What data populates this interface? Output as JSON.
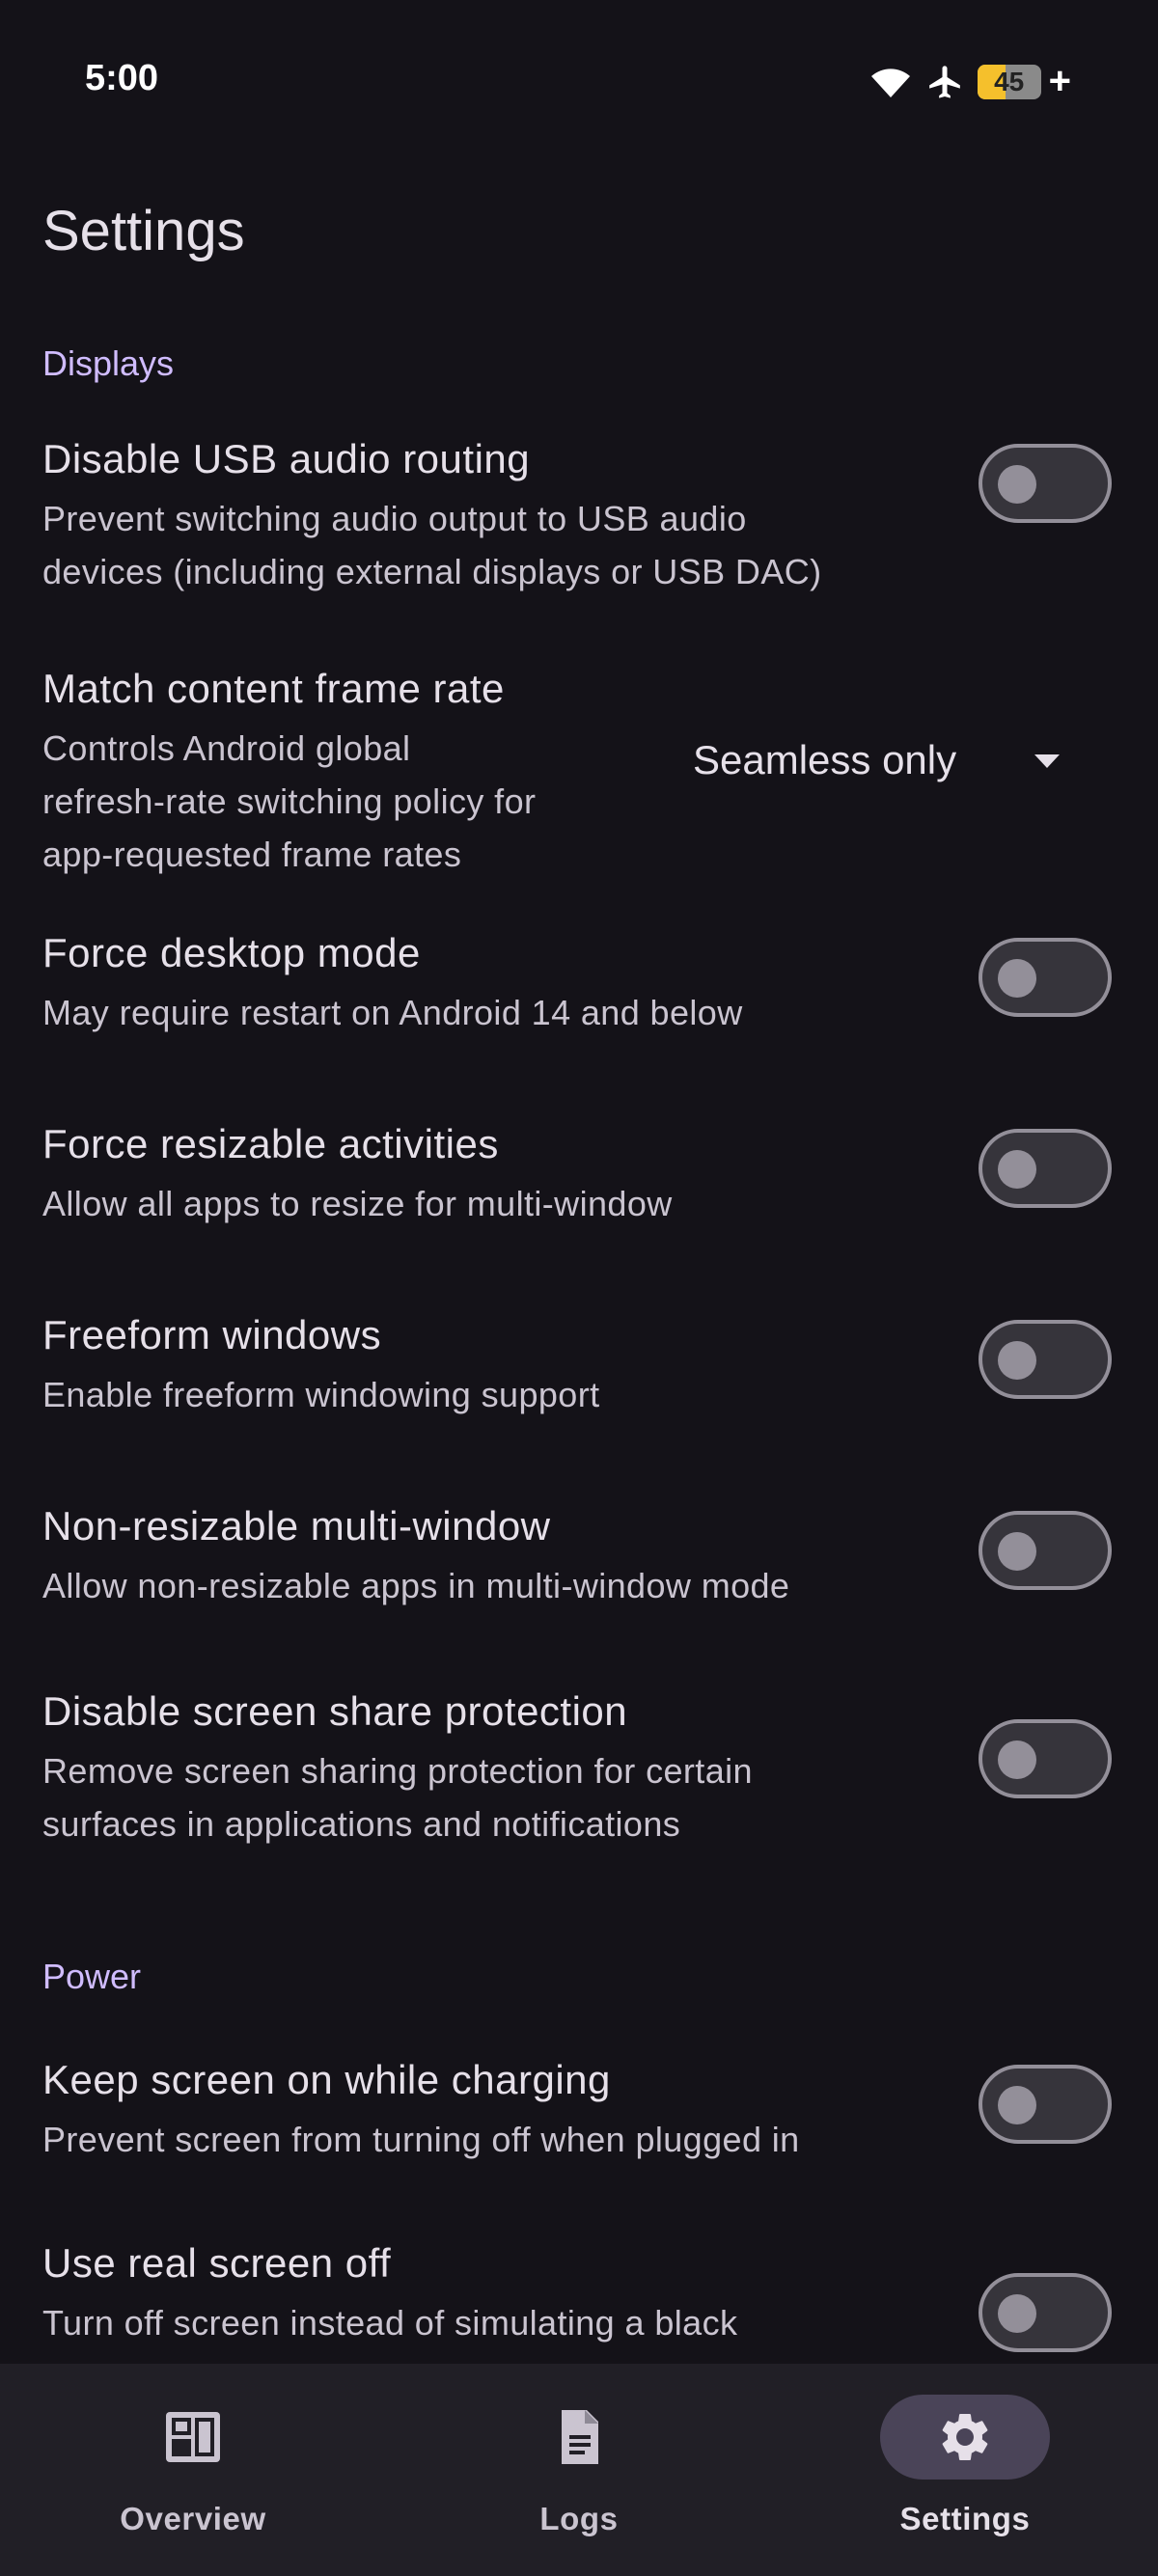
{
  "status_bar": {
    "time": "5:00",
    "battery_percent": 45,
    "battery_label": "45",
    "charging_symbol": "+",
    "icons": [
      "wifi-icon",
      "airplane-icon",
      "battery-icon"
    ]
  },
  "page": {
    "title": "Settings"
  },
  "sections": {
    "displays": {
      "header": "Displays",
      "items": {
        "usb_audio": {
          "title": "Disable USB audio routing",
          "desc_1": "Prevent switching audio output to USB audio",
          "desc_2": "devices (including external displays or USB DAC)",
          "enabled": false
        },
        "frame_rate": {
          "title": "Match content frame rate",
          "desc_1": "Controls Android global",
          "desc_2": "refresh-rate switching policy for",
          "desc_3": "app-requested frame rates",
          "selected": "Seamless only"
        },
        "desktop_mode": {
          "title": "Force desktop mode",
          "desc_1": "May require restart on Android 14 and below",
          "enabled": false
        },
        "resizable": {
          "title": "Force resizable activities",
          "desc_1": "Allow all apps to resize for multi-window",
          "enabled": false
        },
        "freeform": {
          "title": "Freeform windows",
          "desc_1": "Enable freeform windowing support",
          "enabled": false
        },
        "non_resizable": {
          "title": "Non-resizable multi-window",
          "desc_1": "Allow non-resizable apps in multi-window mode",
          "enabled": false
        },
        "screen_share": {
          "title": "Disable screen share protection",
          "desc_1": "Remove screen sharing protection for certain",
          "desc_2": "surfaces in applications and notifications",
          "enabled": false
        }
      }
    },
    "power": {
      "header": "Power",
      "items": {
        "keep_screen_on": {
          "title": "Keep screen on while charging",
          "desc_1": "Prevent screen from turning off when plugged in",
          "enabled": false
        },
        "real_screen_off": {
          "title": "Use real screen off",
          "desc_1": "Turn off screen instead of simulating a black",
          "enabled": false
        }
      }
    }
  },
  "bottom_nav": {
    "overview": "Overview",
    "logs": "Logs",
    "settings": "Settings",
    "active": "settings"
  },
  "colors": {
    "background": "#141218",
    "section_accent": "#d0bcff",
    "nav_background": "#211f26",
    "nav_active_indicator": "#4a4458",
    "battery_fill": "#f5c02c"
  }
}
